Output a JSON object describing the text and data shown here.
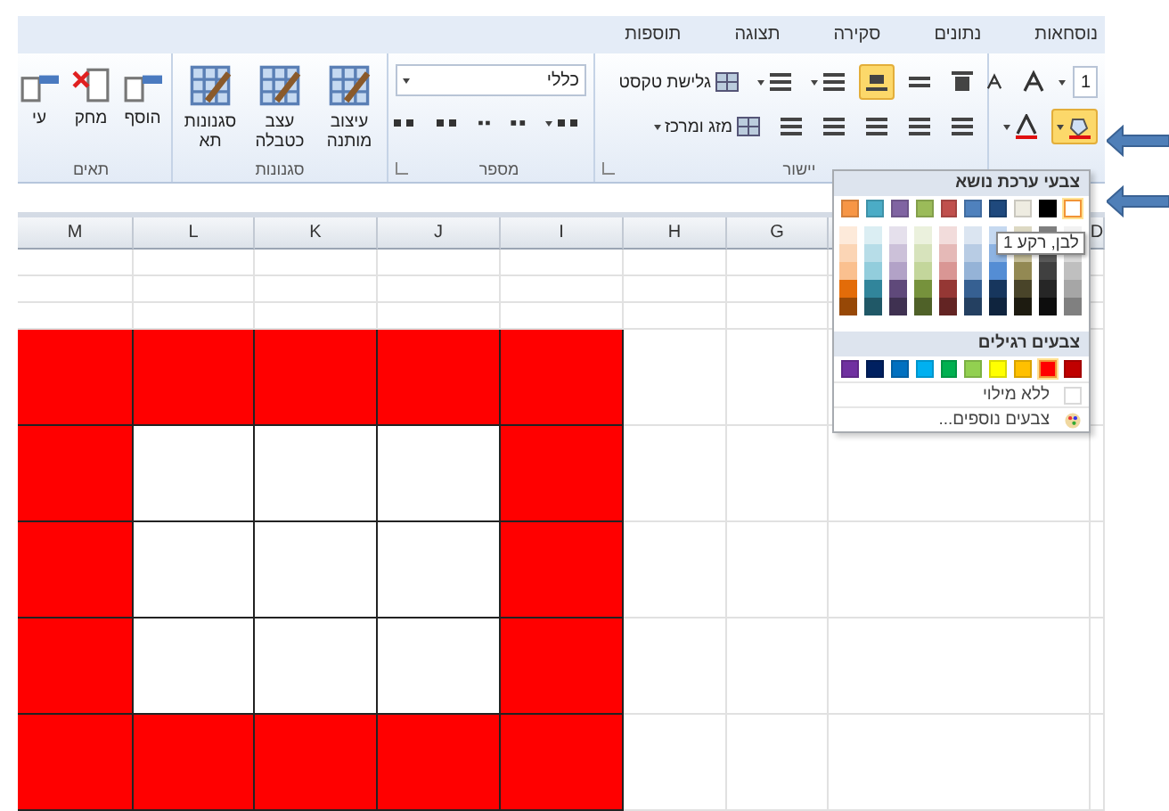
{
  "tabs": [
    {
      "label": "נוסחאות",
      "selected": false
    },
    {
      "label": "נתונים",
      "selected": false
    },
    {
      "label": "סקירה",
      "selected": false
    },
    {
      "label": "תצוגה",
      "selected": false
    },
    {
      "label": "תוספות",
      "selected": false
    }
  ],
  "font_group": {
    "font_size": "1",
    "fill_expanded": true
  },
  "alignment_group": {
    "label": "יישור",
    "wrap_text": "גלישת טקסט",
    "merge_center": "מזג ומרכז",
    "vertical_align": [
      {
        "kind": "top",
        "selected": false
      },
      {
        "kind": "middle",
        "selected": false
      },
      {
        "kind": "bottom",
        "selected": true
      }
    ]
  },
  "number_group": {
    "label": "מספר",
    "format": "כללי"
  },
  "styles_group": {
    "label": "סגנונות",
    "buttons": [
      "עיצוב מותנה",
      "עצב כטבלה",
      "סגנונות תא"
    ]
  },
  "cells_group": {
    "label": "תאים",
    "buttons": [
      "הוסף",
      "מחק",
      "עי"
    ]
  },
  "sheet": {
    "edge_column": "D",
    "columns": [
      "G",
      "H",
      "I",
      "J",
      "K",
      "L",
      "M"
    ],
    "fill_rows": [
      {
        "cells": [
          {
            "color": "#ff0000"
          },
          {
            "color": "#ff0000"
          },
          {
            "color": "#ff0000"
          },
          {
            "color": "#ff0000"
          },
          {
            "color": "#ff0000"
          }
        ]
      },
      {
        "cells": [
          {
            "color": "#ff0000"
          },
          {
            "color": "#ffffff"
          },
          {
            "color": "#ffffff"
          },
          {
            "color": "#ffffff"
          },
          {
            "color": "#ff0000"
          }
        ]
      },
      {
        "cells": [
          {
            "color": "#ff0000"
          },
          {
            "color": "#ffffff"
          },
          {
            "color": "#ffffff"
          },
          {
            "color": "#ffffff"
          },
          {
            "color": "#ff0000"
          }
        ]
      },
      {
        "cells": [
          {
            "color": "#ff0000"
          },
          {
            "color": "#ffffff"
          },
          {
            "color": "#ffffff"
          },
          {
            "color": "#ffffff"
          },
          {
            "color": "#ff0000"
          }
        ]
      },
      {
        "cells": [
          {
            "color": "#ff0000"
          },
          {
            "color": "#ff0000"
          },
          {
            "color": "#ff0000"
          },
          {
            "color": "#ff0000"
          },
          {
            "color": "#ff0000"
          }
        ]
      }
    ]
  },
  "palette": {
    "theme_header": "צבעי ערכת נושא",
    "tooltip": "לבן, רקע 1",
    "standard_header": "צבעים רגילים",
    "no_fill": "ללא מילוי",
    "more_colors": "צבעים נוספים...",
    "theme_colors": [
      {
        "color": "#ffffff",
        "selected": true,
        "shades": [
          {
            "color": "#f2f2f2"
          },
          {
            "color": "#d9d9d9"
          },
          {
            "color": "#bfbfbf"
          },
          {
            "color": "#a6a6a6"
          },
          {
            "color": "#808080"
          }
        ]
      },
      {
        "color": "#000000",
        "selected": false,
        "shades": [
          {
            "color": "#7f7f7f"
          },
          {
            "color": "#595959"
          },
          {
            "color": "#404040"
          },
          {
            "color": "#262626"
          },
          {
            "color": "#0d0d0d"
          }
        ]
      },
      {
        "color": "#eeece1",
        "selected": false,
        "shades": [
          {
            "color": "#ddd9c3"
          },
          {
            "color": "#c4bd97"
          },
          {
            "color": "#938953"
          },
          {
            "color": "#494429"
          },
          {
            "color": "#1d1b10"
          }
        ]
      },
      {
        "color": "#1f497d",
        "selected": false,
        "shades": [
          {
            "color": "#c6d9f0"
          },
          {
            "color": "#8db3e2"
          },
          {
            "color": "#548dd4"
          },
          {
            "color": "#17365d"
          },
          {
            "color": "#0f243e"
          }
        ]
      },
      {
        "color": "#4f81bd",
        "selected": false,
        "shades": [
          {
            "color": "#dbe5f1"
          },
          {
            "color": "#b8cce4"
          },
          {
            "color": "#95b3d7"
          },
          {
            "color": "#366092"
          },
          {
            "color": "#244061"
          }
        ]
      },
      {
        "color": "#c0504d",
        "selected": false,
        "shades": [
          {
            "color": "#f2dcdb"
          },
          {
            "color": "#e5b9b7"
          },
          {
            "color": "#d99694"
          },
          {
            "color": "#953734"
          },
          {
            "color": "#632423"
          }
        ]
      },
      {
        "color": "#9bbb59",
        "selected": false,
        "shades": [
          {
            "color": "#ebf1dd"
          },
          {
            "color": "#d7e3bc"
          },
          {
            "color": "#c3d69b"
          },
          {
            "color": "#76923c"
          },
          {
            "color": "#4f6128"
          }
        ]
      },
      {
        "color": "#8064a2",
        "selected": false,
        "shades": [
          {
            "color": "#e5e0ec"
          },
          {
            "color": "#ccc1d9"
          },
          {
            "color": "#b2a2c7"
          },
          {
            "color": "#5f497a"
          },
          {
            "color": "#3f3151"
          }
        ]
      },
      {
        "color": "#4bacc6",
        "selected": false,
        "shades": [
          {
            "color": "#dbeef3"
          },
          {
            "color": "#b7dde8"
          },
          {
            "color": "#92cddc"
          },
          {
            "color": "#31859b"
          },
          {
            "color": "#205867"
          }
        ]
      },
      {
        "color": "#f79646",
        "selected": false,
        "shades": [
          {
            "color": "#fdeada"
          },
          {
            "color": "#fbd5b5"
          },
          {
            "color": "#fac08f"
          },
          {
            "color": "#e36c09"
          },
          {
            "color": "#974806"
          }
        ]
      }
    ],
    "standard_colors": [
      {
        "color": "#c00000",
        "selected": false
      },
      {
        "color": "#ff0000",
        "selected": true
      },
      {
        "color": "#ffc000",
        "selected": false
      },
      {
        "color": "#ffff00",
        "selected": false
      },
      {
        "color": "#92d050",
        "selected": false
      },
      {
        "color": "#00b050",
        "selected": false
      },
      {
        "color": "#00b0f0",
        "selected": false
      },
      {
        "color": "#0070c0",
        "selected": false
      },
      {
        "color": "#002060",
        "selected": false
      },
      {
        "color": "#7030a0",
        "selected": false
      }
    ]
  }
}
